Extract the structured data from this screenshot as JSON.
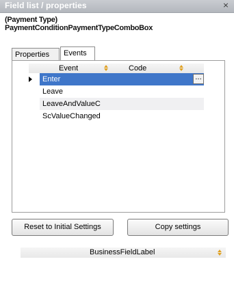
{
  "window": {
    "title": "Field list / properties",
    "close_glyph": "×"
  },
  "header": {
    "line1": "(Payment Type)",
    "line2": "PaymentConditionPaymentTypeComboBox"
  },
  "tabs": [
    {
      "label": "Properties"
    },
    {
      "label": "Events"
    }
  ],
  "grid": {
    "columns": [
      "Event",
      "Code"
    ],
    "rows": [
      {
        "event": "Enter",
        "code": ""
      },
      {
        "event": "Leave",
        "code": ""
      },
      {
        "event": "LeaveAndValueC",
        "code": ""
      },
      {
        "event": "ScValueChanged",
        "code": ""
      }
    ],
    "ellipsis": "..."
  },
  "buttons": {
    "reset": "Reset to Initial Settings",
    "copy": "Copy settings"
  },
  "bottom": {
    "column_label": "BusinessFieldLabel"
  },
  "colors": {
    "selection": "#3f76c9",
    "sort_icon": "#e0a020"
  }
}
